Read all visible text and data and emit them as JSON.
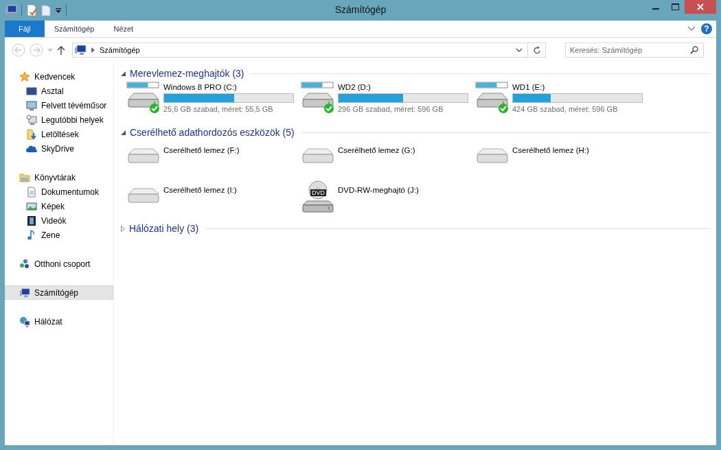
{
  "window": {
    "title": "Számítógép"
  },
  "help": {
    "label": "?"
  },
  "ribbon_tabs": [
    {
      "label": "Fájl",
      "selected": true
    },
    {
      "label": "Számítógép",
      "selected": false
    },
    {
      "label": "Nézet",
      "selected": false
    }
  ],
  "address": {
    "path": "Számítógép"
  },
  "search": {
    "placeholder": "Keresés: Számítógép"
  },
  "sidebar": {
    "groups": [
      {
        "label": "Kedvencek",
        "kind": "star",
        "selected": false,
        "children": [
          {
            "label": "Asztal",
            "kind": "desktop",
            "selected": false
          },
          {
            "label": "Felvett tévéműsor",
            "kind": "monitor",
            "selected": false
          },
          {
            "label": "Legutóbbi helyek",
            "kind": "recent",
            "selected": false
          },
          {
            "label": "Letöltések",
            "kind": "download",
            "selected": false
          },
          {
            "label": "SkyDrive",
            "kind": "cloud",
            "selected": false
          }
        ]
      },
      {
        "label": "Könyvtárak",
        "kind": "library",
        "selected": false,
        "children": [
          {
            "label": "Dokumentumok",
            "kind": "document",
            "selected": false
          },
          {
            "label": "Képek",
            "kind": "picture",
            "selected": false
          },
          {
            "label": "Videók",
            "kind": "video",
            "selected": false
          },
          {
            "label": "Zene",
            "kind": "music",
            "selected": false
          }
        ]
      },
      {
        "label": "Otthoni csoport",
        "kind": "homegroup",
        "selected": false
      },
      {
        "label": "Számítógép",
        "kind": "computer",
        "selected": true
      },
      {
        "label": "Hálózat",
        "kind": "network",
        "selected": false
      }
    ]
  },
  "sections": [
    {
      "title": "Merevlemez-meghajtók (3)",
      "expanded": true,
      "items": [
        {
          "kind": "hdd",
          "name": "Windows 8 PRO (C:)",
          "level": 0.54,
          "info": "25,6 GB szabad, méret: 55,5 GB"
        },
        {
          "kind": "hdd",
          "name": "WD2 (D:)",
          "level": 0.5,
          "info": "296 GB szabad, méret: 596 GB"
        },
        {
          "kind": "hdd",
          "name": "WD1 (E:)",
          "level": 0.29,
          "info": "424 GB szabad, méret: 596 GB"
        }
      ]
    },
    {
      "title": "Cserélhető adathordozós eszközök (5)",
      "expanded": true,
      "items": [
        {
          "kind": "removable",
          "name": "Cserélhető lemez (F:)"
        },
        {
          "kind": "removable",
          "name": "Cserélhető lemez (G:)"
        },
        {
          "kind": "removable",
          "name": "Cserélhető lemez (H:)"
        },
        {
          "kind": "removable",
          "name": "Cserélhető lemez (I:)"
        },
        {
          "kind": "dvd",
          "name": "DVD-RW-meghajtó (J:)",
          "badge": "DVD"
        }
      ]
    },
    {
      "title": "Hálózati hely (3)",
      "expanded": false
    }
  ]
}
